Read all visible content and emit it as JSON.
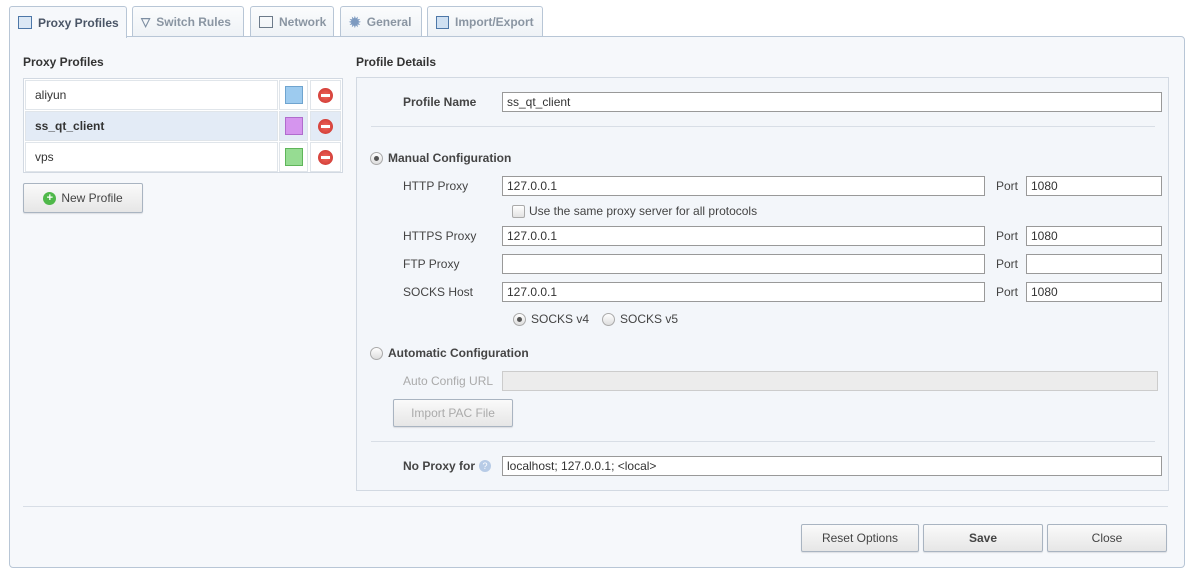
{
  "tabs": [
    {
      "label": "Proxy Profiles",
      "icon": "profile-list-icon",
      "active": true
    },
    {
      "label": "Switch Rules",
      "icon": "filter-icon"
    },
    {
      "label": "Network",
      "icon": "network-icon"
    },
    {
      "label": "General",
      "icon": "gear-icon"
    },
    {
      "label": "Import/Export",
      "icon": "floppy-disk-icon"
    }
  ],
  "profiles": {
    "title": "Proxy Profiles",
    "items": [
      {
        "name": "aliyun",
        "color": "#9dcbef"
      },
      {
        "name": "ss_qt_client",
        "color": "#d595ee",
        "selected": true
      },
      {
        "name": "vps",
        "color": "#96dc92"
      }
    ],
    "new_label": "New Profile"
  },
  "details": {
    "title": "Profile Details",
    "profile_name_label": "Profile Name",
    "profile_name": "ss_qt_client",
    "manual_label": "Manual Configuration",
    "manual_selected": true,
    "http_label": "HTTP Proxy",
    "http_value": "127.0.0.1",
    "http_port": "1080",
    "port_label": "Port",
    "same_proxy_label": "Use the same proxy server for all protocols",
    "same_proxy_checked": false,
    "https_label": "HTTPS Proxy",
    "https_value": "127.0.0.1",
    "https_port": "1080",
    "ftp_label": "FTP Proxy",
    "ftp_value": "",
    "ftp_port": "",
    "socks_label": "SOCKS Host",
    "socks_value": "127.0.0.1",
    "socks_port": "1080",
    "socks_v4": "SOCKS v4",
    "socks_v5": "SOCKS v5",
    "socks_version": "v4",
    "auto_label": "Automatic Configuration",
    "auto_url_label": "Auto Config URL",
    "auto_url": "",
    "import_pac": "Import PAC File",
    "no_proxy_label": "No Proxy for",
    "no_proxy_value": "localhost; 127.0.0.1; <local>"
  },
  "footer": {
    "reset": "Reset Options",
    "save": "Save",
    "close": "Close"
  }
}
